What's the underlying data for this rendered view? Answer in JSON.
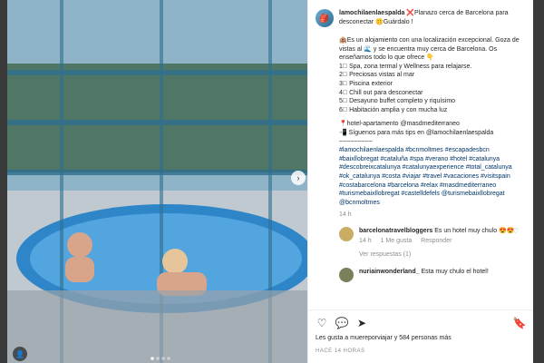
{
  "app": {
    "user": "lamochilaenlaespalda",
    "caption_lines": [
      "❌Planazo cerca de Barcelona para desconectar 🤫Guárdalo !"
    ],
    "post_text": [
      "🏨Es un alojamiento con una localización excepcional. Goza de vistas al 🌊 y se encuentra muy cerca de Barcelona. Os enseñamos todo lo que ofrece 👇",
      "1⃣ Spa, zona termal y Wellness para relajarse.",
      "2⃣ Preciosas vistas al mar",
      "3⃣ Piscina exterior",
      "4⃣ Chill out para desconectar",
      "5⃣ Desayuno buffet completo y riquísimo",
      "6⃣ Habitación amplia y con mucha luz",
      "📍hotel-apartamento @masdmediterraneo",
      "📲 Síguenos para más tips en @lamochilaenlaespalda",
      "~~~~~~~~~",
      "#lamochilaenlaespalda #bcnmoltmes #escapadesbcn #baixllobregat #cataluña #spa #verano #hotel #catalunya #descobreixcatalunya #catalunyaexperience #total_catalunya #ok_catalunya #costa #viajar #travel #vacaciones #visitspain #costabarcelona #barcelona #relax #masdmediterraneo #turismebaixllobregat #castelldefels @turismebaixllobregat @bcnmoltmes"
    ],
    "post_age": "14 h",
    "comments": [
      {
        "user": "barcelonatravelbloggers",
        "text": "Es un hotel muy chulo 😍😍",
        "meta_time": "14 h",
        "meta_likes": "1 Me gusta",
        "reply": "Responder",
        "view_replies": "Ver respuestas (1)"
      },
      {
        "user": "nuriainwonderland_",
        "text": "Esta muy chulo el hotel!"
      }
    ],
    "likes_text": "Les gusta a muereporviajar y 584 personas más",
    "posted_when": "HACE 14 HORAS"
  }
}
